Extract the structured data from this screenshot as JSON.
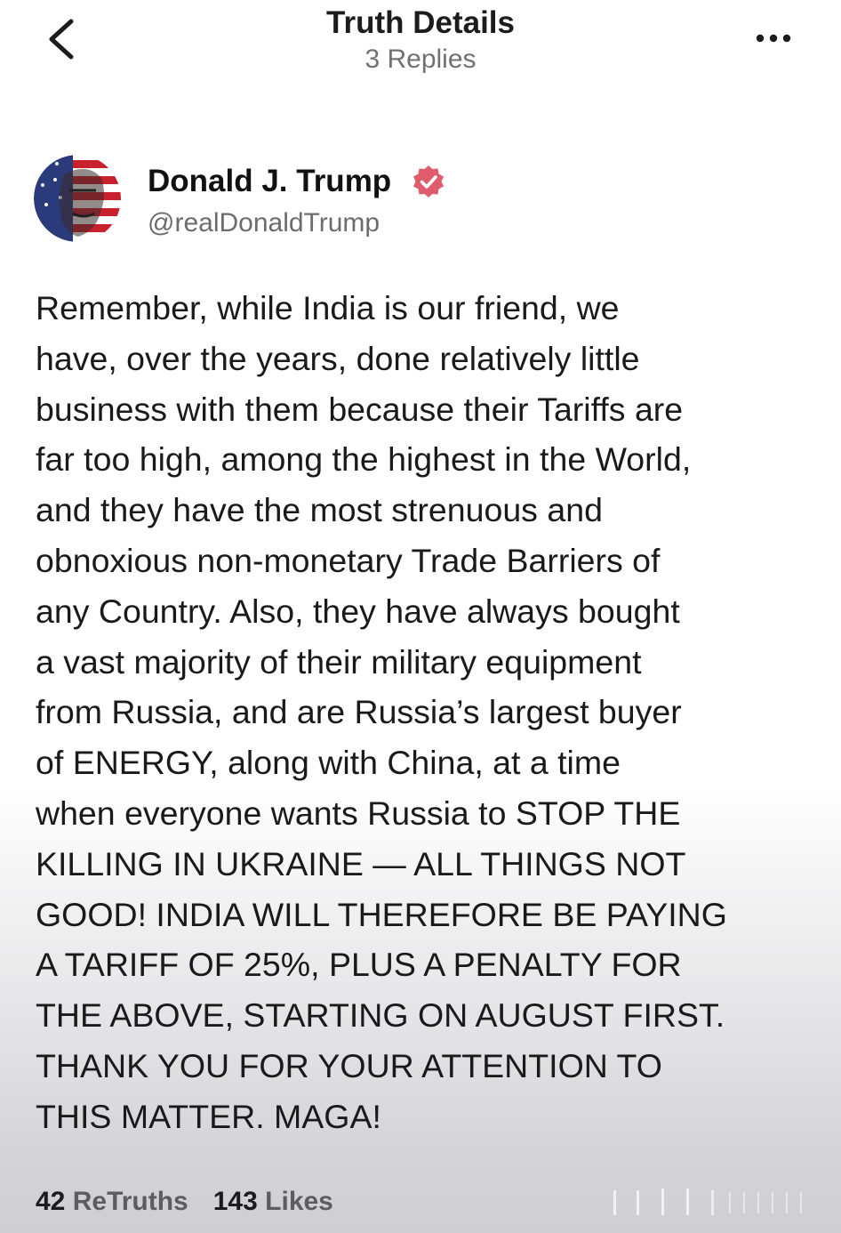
{
  "header": {
    "title": "Truth Details",
    "subtitle": "3 Replies"
  },
  "post": {
    "author_name": "Donald J. Trump",
    "handle": "@realDonaldTrump",
    "text": "Remember, while India is our friend, we\nhave, over the years, done relatively little\nbusiness with them because their Tariffs are\nfar too high, among the highest in the World,\nand they have the most strenuous and\nobnoxious non-monetary Trade Barriers of\nany Country. Also, they have always bought\na vast majority of their military equipment\nfrom Russia, and are Russia’s largest buyer\nof ENERGY, along with China, at a time\nwhen everyone wants Russia to STOP THE\nKILLING IN UKRAINE — ALL THINGS NOT\nGOOD! INDIA WILL THEREFORE BE PAYING\nA TARIFF OF 25%, PLUS A PENALTY FOR\nTHE ABOVE, STARTING ON AUGUST FIRST.\nTHANK YOU FOR YOUR ATTENTION TO\nTHIS MATTER. MAGA!"
  },
  "stats": {
    "retruths_count": "42",
    "retruths_label": "ReTruths",
    "likes_count": "143",
    "likes_label": "Likes"
  },
  "icons": {
    "back": "chevron-left-icon",
    "more": "more-horizontal-icon",
    "verified": "verified-badge-icon"
  },
  "colors": {
    "verified_badge": "#e05b6b",
    "secondary_text": "#6b6b70"
  }
}
